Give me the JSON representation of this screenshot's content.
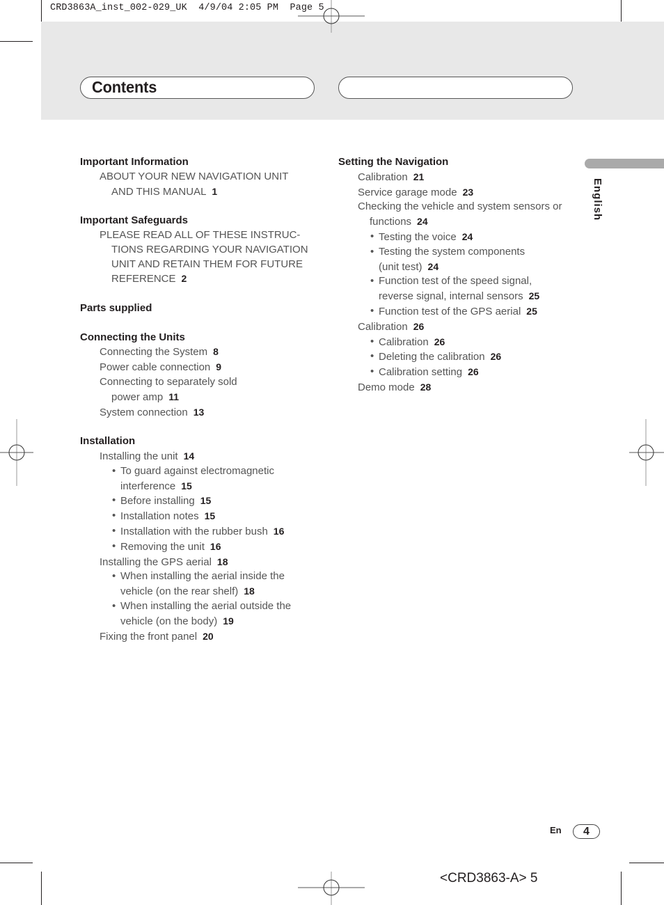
{
  "slug": "CRD3863A_inst_002-029_UK  4/9/04 2:05 PM  Page 5",
  "header": {
    "title": "Contents",
    "right_box": ""
  },
  "language_tab": "English",
  "toc_left": [
    {
      "heading": "Important Information",
      "entries": [
        {
          "level": 1,
          "lines": [
            "ABOUT YOUR NEW NAVIGATION UNIT",
            "AND THIS MANUAL"
          ],
          "page": "1"
        }
      ]
    },
    {
      "heading": "Important Safeguards",
      "entries": [
        {
          "level": 1,
          "lines": [
            "PLEASE READ ALL OF THESE INSTRUC-",
            "TIONS REGARDING YOUR NAVIGATION",
            "UNIT AND RETAIN THEM FOR FUTURE",
            "REFERENCE"
          ],
          "page": "2"
        }
      ]
    },
    {
      "heading": "Parts supplied",
      "entries": []
    },
    {
      "heading": "Connecting the Units",
      "entries": [
        {
          "level": 1,
          "lines": [
            "Connecting the System"
          ],
          "page": "8"
        },
        {
          "level": 1,
          "lines": [
            "Power cable connection"
          ],
          "page": "9"
        },
        {
          "level": 1,
          "lines": [
            "Connecting to separately sold",
            "power amp"
          ],
          "page": "11"
        },
        {
          "level": 1,
          "lines": [
            "System connection"
          ],
          "page": "13"
        }
      ]
    },
    {
      "heading": "Installation",
      "entries": [
        {
          "level": 1,
          "lines": [
            "Installing the unit"
          ],
          "page": "14"
        },
        {
          "level": 2,
          "lines": [
            "To guard against electromagnetic",
            "interference"
          ],
          "page": "15"
        },
        {
          "level": 2,
          "lines": [
            "Before installing"
          ],
          "page": "15"
        },
        {
          "level": 2,
          "lines": [
            "Installation notes"
          ],
          "page": "15"
        },
        {
          "level": 2,
          "lines": [
            "Installation with the rubber bush"
          ],
          "page": "16"
        },
        {
          "level": 2,
          "lines": [
            "Removing the unit"
          ],
          "page": "16"
        },
        {
          "level": 1,
          "lines": [
            "Installing the GPS aerial"
          ],
          "page": "18"
        },
        {
          "level": 2,
          "lines": [
            "When installing the aerial inside the",
            "vehicle (on the rear shelf)"
          ],
          "page": "18"
        },
        {
          "level": 2,
          "lines": [
            "When installing the aerial outside the",
            "vehicle (on the body)"
          ],
          "page": "19"
        },
        {
          "level": 1,
          "lines": [
            "Fixing the front panel"
          ],
          "page": "20"
        }
      ]
    }
  ],
  "toc_right": [
    {
      "heading": "Setting the Navigation",
      "entries": [
        {
          "level": 1,
          "lines": [
            "Calibration"
          ],
          "page": "21"
        },
        {
          "level": 1,
          "lines": [
            "Service garage mode"
          ],
          "page": "23"
        },
        {
          "level": 1,
          "lines": [
            "Checking the vehicle and system sensors or",
            "functions"
          ],
          "page": "24"
        },
        {
          "level": 2,
          "lines": [
            "Testing the voice"
          ],
          "page": "24"
        },
        {
          "level": 2,
          "lines": [
            "Testing the system components",
            "(unit test)"
          ],
          "page": "24"
        },
        {
          "level": 2,
          "lines": [
            "Function test of the speed signal,",
            "reverse signal, internal sensors"
          ],
          "page": "25"
        },
        {
          "level": 2,
          "lines": [
            "Function test of the GPS aerial"
          ],
          "page": "25"
        },
        {
          "level": 1,
          "lines": [
            "Calibration"
          ],
          "page": "26"
        },
        {
          "level": 2,
          "lines": [
            "Calibration"
          ],
          "page": "26"
        },
        {
          "level": 2,
          "lines": [
            "Deleting the calibration"
          ],
          "page": "26"
        },
        {
          "level": 2,
          "lines": [
            "Calibration setting"
          ],
          "page": "26"
        },
        {
          "level": 1,
          "lines": [
            "Demo mode"
          ],
          "page": "28"
        }
      ]
    }
  ],
  "footer": {
    "lang_code": "En",
    "page_number": "4",
    "doc_code": "<CRD3863-A> 5"
  },
  "icons": {
    "registration_mark": "crosshair-circle",
    "bullet": "•"
  }
}
